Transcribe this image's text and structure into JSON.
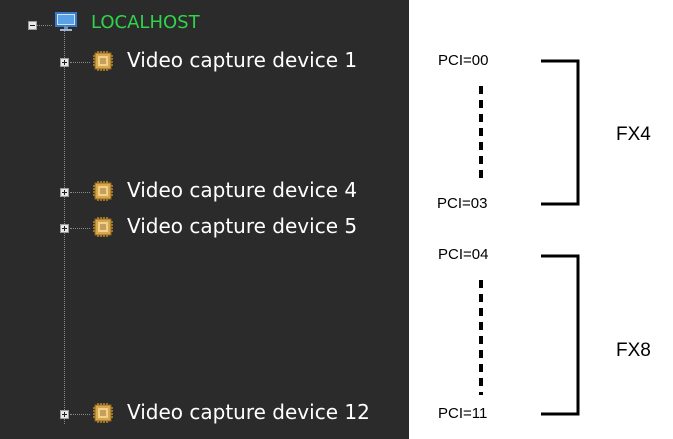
{
  "tree": {
    "root": {
      "label": "LOCALHOST",
      "icon": "monitor-icon",
      "expander_state": "expanded",
      "color": "#2fd44a"
    },
    "devices": [
      {
        "label": "Video capture device 1",
        "icon": "chip-icon",
        "expander_state": "collapsed"
      },
      {
        "label": "Video capture device 4",
        "icon": "chip-icon",
        "expander_state": "collapsed"
      },
      {
        "label": "Video capture device 5",
        "icon": "chip-icon",
        "expander_state": "collapsed"
      },
      {
        "label": "Video capture device 12",
        "icon": "chip-icon",
        "expander_state": "collapsed"
      }
    ],
    "panel_color": "#2b2b2b"
  },
  "annotations": {
    "pci_labels": [
      "PCI=00",
      "PCI=03",
      "PCI=04",
      "PCI=11"
    ],
    "groups": [
      {
        "label": "FX4"
      },
      {
        "label": "FX8"
      }
    ]
  }
}
